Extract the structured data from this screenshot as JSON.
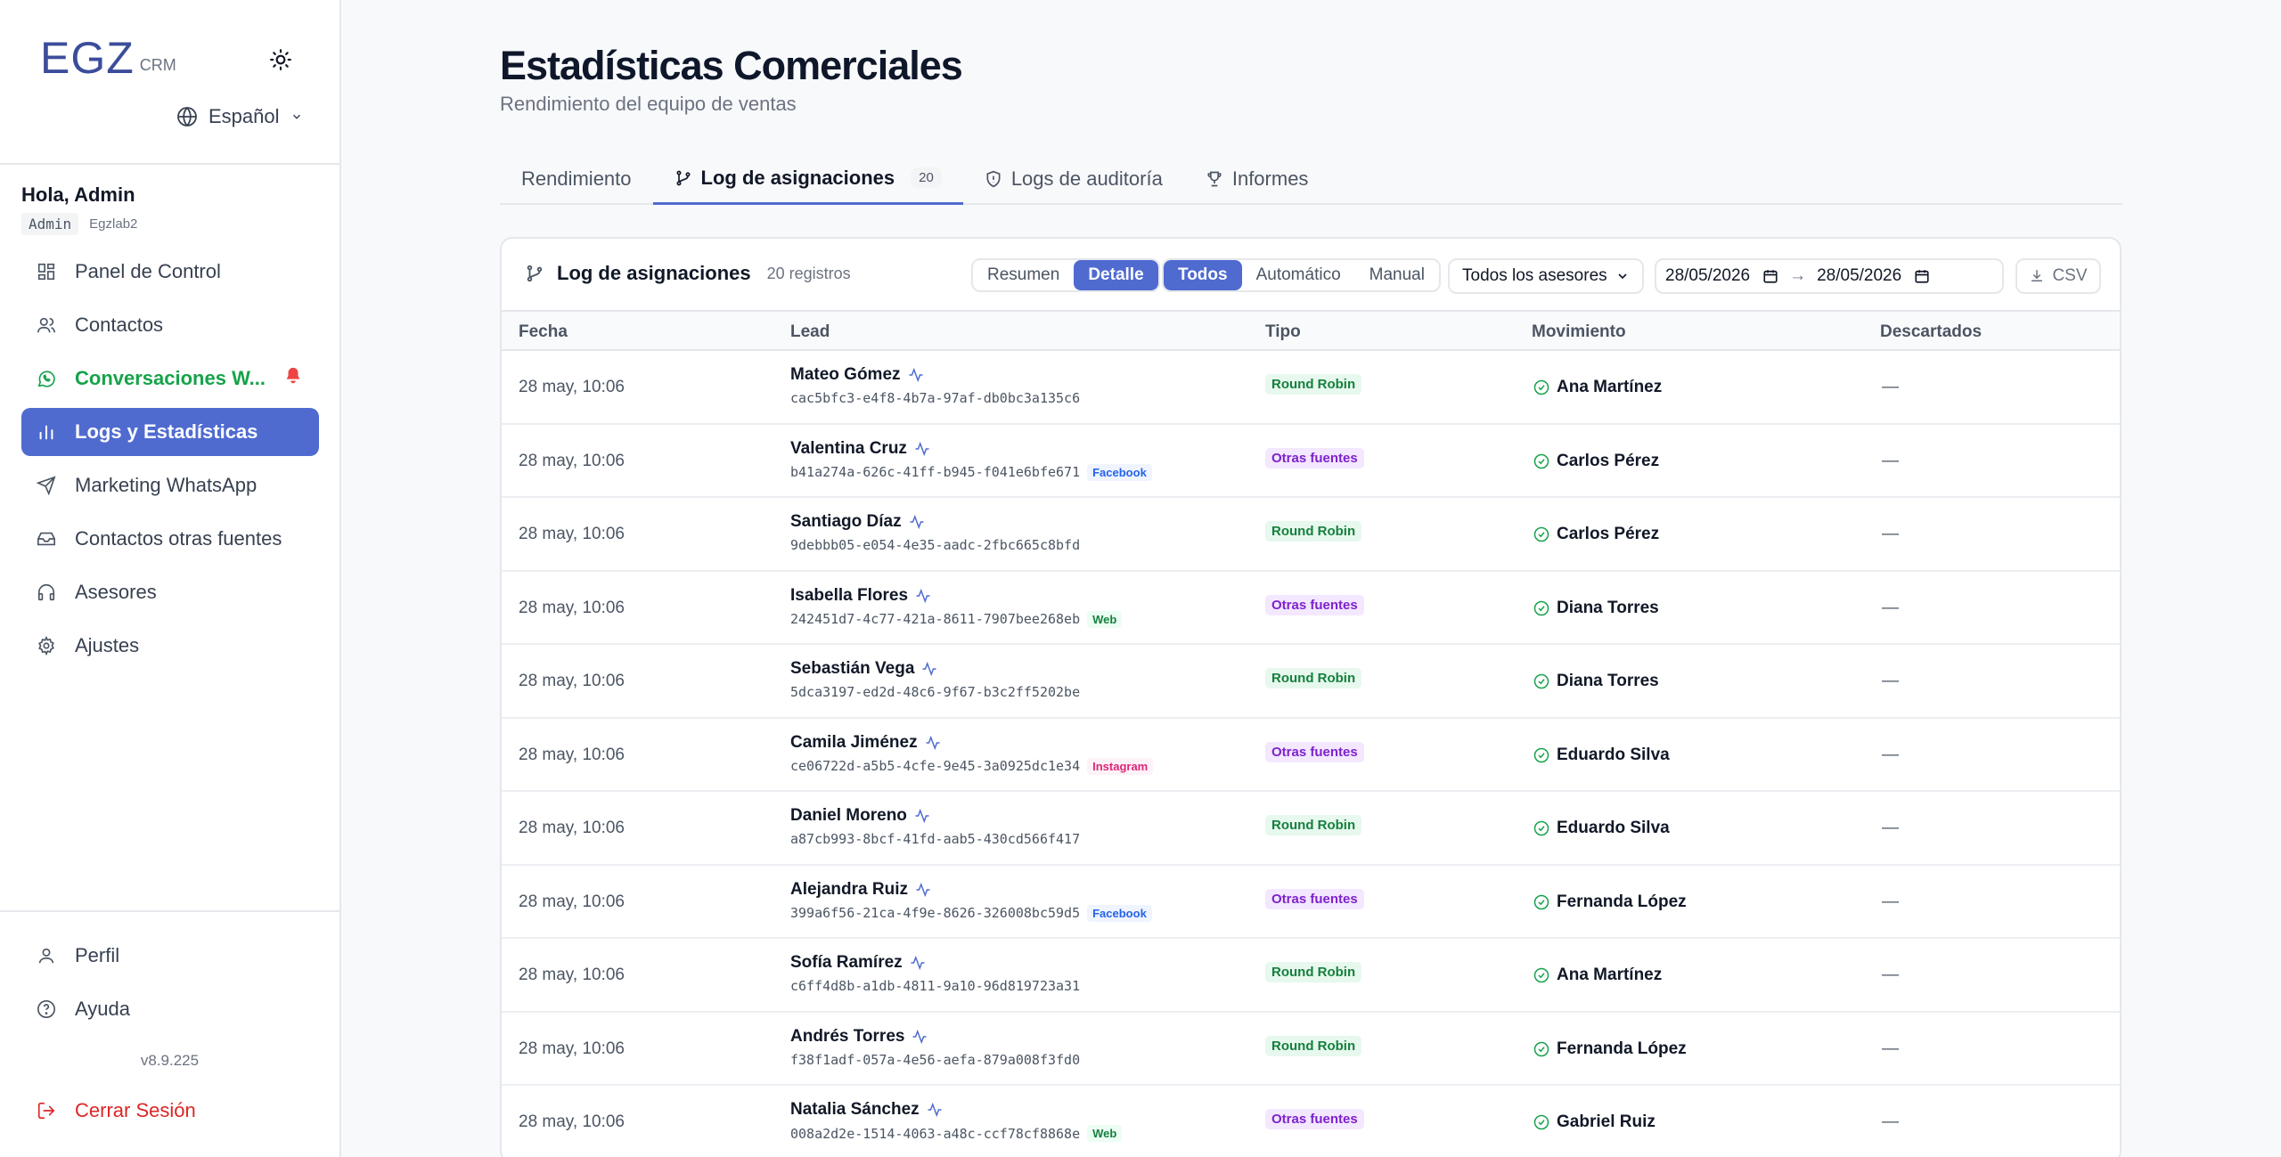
{
  "brand": {
    "name": "EGZ",
    "suffix": "CRM"
  },
  "language": {
    "selected": "Español"
  },
  "user": {
    "greeting": "Hola, Admin",
    "role": "Admin",
    "username": "Egzlab2"
  },
  "nav": [
    {
      "label": "Panel de Control",
      "icon": "grid-icon"
    },
    {
      "label": "Contactos",
      "icon": "users-icon"
    },
    {
      "label": "Conversaciones W...",
      "icon": "whatsapp-icon"
    },
    {
      "label": "Logs y Estadísticas",
      "icon": "bar-chart-icon"
    },
    {
      "label": "Marketing WhatsApp",
      "icon": "send-icon"
    },
    {
      "label": "Contactos otras fuentes",
      "icon": "inbox-icon"
    },
    {
      "label": "Asesores",
      "icon": "headphones-icon"
    },
    {
      "label": "Ajustes",
      "icon": "gear-icon"
    }
  ],
  "bottom_nav": [
    {
      "label": "Perfil",
      "icon": "user-icon"
    },
    {
      "label": "Ayuda",
      "icon": "help-icon"
    }
  ],
  "version": "v8.9.225",
  "logout": "Cerrar Sesión",
  "page": {
    "title": "Estadísticas Comerciales",
    "subtitle": "Rendimiento del equipo de ventas"
  },
  "tabs": [
    {
      "label": "Rendimiento"
    },
    {
      "label": "Log de asignaciones",
      "count": "20"
    },
    {
      "label": "Logs de auditoría"
    },
    {
      "label": "Informes"
    }
  ],
  "card": {
    "title": "Log de asignaciones",
    "count": "20 registros",
    "view": [
      "Resumen",
      "Detalle"
    ],
    "mode": [
      "Todos",
      "Automático",
      "Manual"
    ],
    "advisor_select": "Todos los asesores",
    "date_from": "28/05/2026",
    "date_to": "28/05/2026",
    "arrow": "→",
    "csv": "CSV"
  },
  "columns": [
    "Fecha",
    "Lead",
    "Tipo",
    "Movimiento",
    "Descartados"
  ],
  "rows": [
    {
      "date": "28 may, 10:06",
      "name": "Mateo Gómez",
      "id": "cac5bfc3-e4f8-4b7a-97af-db0bc3a135c6",
      "source": "",
      "type": "Round Robin",
      "advisor": "Ana Martínez",
      "discarded": "—"
    },
    {
      "date": "28 may, 10:06",
      "name": "Valentina Cruz",
      "id": "b41a274a-626c-41ff-b945-f041e6bfe671",
      "source": "Facebook",
      "type": "Otras fuentes",
      "advisor": "Carlos Pérez",
      "discarded": "—"
    },
    {
      "date": "28 may, 10:06",
      "name": "Santiago Díaz",
      "id": "9debbb05-e054-4e35-aadc-2fbc665c8bfd",
      "source": "",
      "type": "Round Robin",
      "advisor": "Carlos Pérez",
      "discarded": "—"
    },
    {
      "date": "28 may, 10:06",
      "name": "Isabella Flores",
      "id": "242451d7-4c77-421a-8611-7907bee268eb",
      "source": "Web",
      "type": "Otras fuentes",
      "advisor": "Diana Torres",
      "discarded": "—"
    },
    {
      "date": "28 may, 10:06",
      "name": "Sebastián Vega",
      "id": "5dca3197-ed2d-48c6-9f67-b3c2ff5202be",
      "source": "",
      "type": "Round Robin",
      "advisor": "Diana Torres",
      "discarded": "—"
    },
    {
      "date": "28 may, 10:06",
      "name": "Camila Jiménez",
      "id": "ce06722d-a5b5-4cfe-9e45-3a0925dc1e34",
      "source": "Instagram",
      "type": "Otras fuentes",
      "advisor": "Eduardo Silva",
      "discarded": "—"
    },
    {
      "date": "28 may, 10:06",
      "name": "Daniel Moreno",
      "id": "a87cb993-8bcf-41fd-aab5-430cd566f417",
      "source": "",
      "type": "Round Robin",
      "advisor": "Eduardo Silva",
      "discarded": "—"
    },
    {
      "date": "28 may, 10:06",
      "name": "Alejandra Ruiz",
      "id": "399a6f56-21ca-4f9e-8626-326008bc59d5",
      "source": "Facebook",
      "type": "Otras fuentes",
      "advisor": "Fernanda López",
      "discarded": "—"
    },
    {
      "date": "28 may, 10:06",
      "name": "Sofía Ramírez",
      "id": "c6ff4d8b-a1db-4811-9a10-96d819723a31",
      "source": "",
      "type": "Round Robin",
      "advisor": "Ana Martínez",
      "discarded": "—"
    },
    {
      "date": "28 may, 10:06",
      "name": "Andrés Torres",
      "id": "f38f1adf-057a-4e56-aefa-879a008f3fd0",
      "source": "",
      "type": "Round Robin",
      "advisor": "Fernanda López",
      "discarded": "—"
    },
    {
      "date": "28 may, 10:06",
      "name": "Natalia Sánchez",
      "id": "008a2d2e-1514-4063-a48c-ccf78cf8868e",
      "source": "Web",
      "type": "Otras fuentes",
      "advisor": "Gabriel Ruiz",
      "discarded": "—"
    }
  ]
}
